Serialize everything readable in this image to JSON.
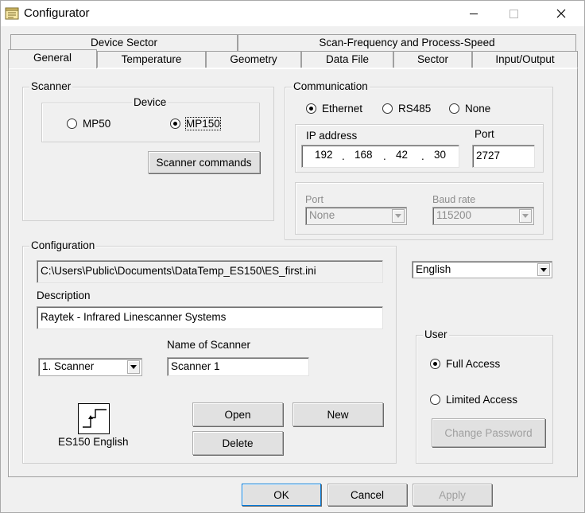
{
  "window": {
    "title": "Configurator",
    "minimize": "—",
    "maximize": "☐",
    "close": "✕"
  },
  "tabs": {
    "row_back": [
      "Device Sector",
      "Scan-Frequency and Process-Speed"
    ],
    "row_front": [
      "General",
      "Temperature",
      "Geometry",
      "Data File",
      "Sector",
      "Input/Output"
    ]
  },
  "scanner": {
    "group_label": "Scanner",
    "device_label": "Device",
    "options": [
      "MP50",
      "MP150"
    ],
    "selected": "MP150",
    "commands_button": "Scanner commands"
  },
  "communication": {
    "group_label": "Communication",
    "options": [
      "Ethernet",
      "RS485",
      "None"
    ],
    "selected": "Ethernet",
    "ip_label": "IP address",
    "ip": [
      "192",
      "168",
      "42",
      "30"
    ],
    "ip_dot": ".",
    "port_label": "Port",
    "port": "2727",
    "serial_port_label": "Port",
    "serial_port_value": "None",
    "baud_label": "Baud rate",
    "baud_value": "115200"
  },
  "configuration": {
    "group_label": "Configuration",
    "path": "C:\\Users\\Public\\Documents\\DataTemp_ES150\\ES_first.ini",
    "description_label": "Description",
    "description": "Raytek - Infrared Linescanner Systems",
    "scanner_select": "1. Scanner",
    "name_label": "Name of Scanner",
    "name": "Scanner 1",
    "device_caption": "ES150 English",
    "open_button": "Open",
    "new_button": "New",
    "delete_button": "Delete"
  },
  "language": {
    "value": "English"
  },
  "user": {
    "group_label": "User",
    "options": [
      "Full Access",
      "Limited Access"
    ],
    "selected": "Full Access",
    "change_password": "Change Password"
  },
  "footer": {
    "ok": "OK",
    "cancel": "Cancel",
    "apply": "Apply"
  }
}
